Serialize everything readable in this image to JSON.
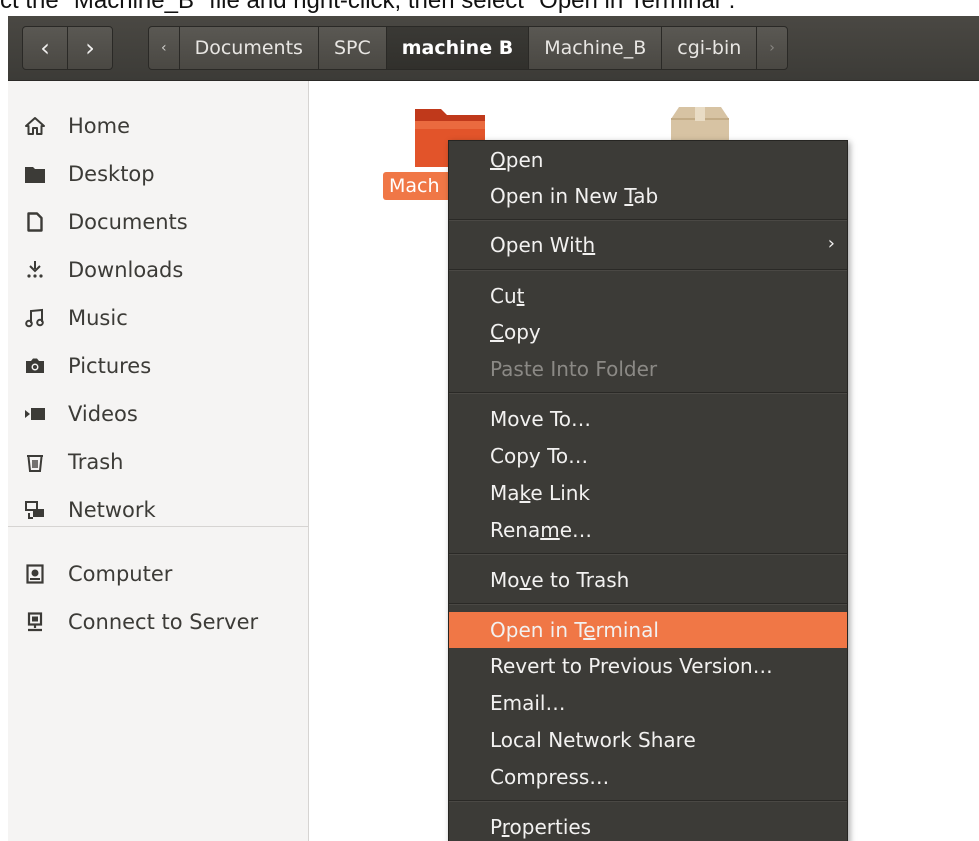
{
  "caption": {
    "text": "ct the \"Machine_B\" file and right-click, then select \"Open in Terminal\"."
  },
  "toolbar": {
    "back_glyph": "‹",
    "forward_glyph": "›",
    "crumb_left_arrow": "‹",
    "crumbs": [
      "Documents",
      "SPC",
      "machine B",
      "Machine_B",
      "cgi-bin"
    ],
    "crumb_right_arrow": "›"
  },
  "sidebar": {
    "items": [
      {
        "label": "Home",
        "icon": "home-icon"
      },
      {
        "label": "Desktop",
        "icon": "desktop-icon"
      },
      {
        "label": "Documents",
        "icon": "document-icon"
      },
      {
        "label": "Downloads",
        "icon": "download-icon"
      },
      {
        "label": "Music",
        "icon": "music-icon"
      },
      {
        "label": "Pictures",
        "icon": "camera-icon"
      },
      {
        "label": "Videos",
        "icon": "video-icon"
      },
      {
        "label": "Trash",
        "icon": "trash-icon"
      },
      {
        "label": "Network",
        "icon": "network-icon"
      },
      {
        "label": "Computer",
        "icon": "computer-icon"
      },
      {
        "label": "Connect to Server",
        "icon": "server-icon"
      }
    ]
  },
  "main": {
    "folder_label": "Mach",
    "folder_color": "#e2542a",
    "selection_color": "#f07746"
  },
  "context_menu": {
    "items": [
      {
        "pre": "",
        "u": "O",
        "post": "pen"
      },
      {
        "pre": "Open in New ",
        "u": "T",
        "post": "ab"
      },
      {
        "pre": "Open Wit",
        "u": "h",
        "post": "",
        "arrow": "›"
      },
      {
        "pre": "Cu",
        "u": "t",
        "post": ""
      },
      {
        "pre": "",
        "u": "C",
        "post": "opy"
      },
      {
        "pre": "Paste Into Folder",
        "u": "",
        "post": ""
      },
      {
        "pre": "Move To…",
        "u": "",
        "post": ""
      },
      {
        "pre": "Copy To…",
        "u": "",
        "post": ""
      },
      {
        "pre": "Ma",
        "u": "k",
        "post": "e Link"
      },
      {
        "pre": "Rena",
        "u": "m",
        "post": "e…"
      },
      {
        "pre": "Mo",
        "u": "v",
        "post": "e to Trash"
      },
      {
        "pre": "Open in T",
        "u": "e",
        "post": "rminal"
      },
      {
        "pre": "Revert to Previous Version…",
        "u": "",
        "post": ""
      },
      {
        "pre": "Email…",
        "u": "",
        "post": ""
      },
      {
        "pre": "Local Network Share",
        "u": "",
        "post": ""
      },
      {
        "pre": "Compress…",
        "u": "",
        "post": ""
      },
      {
        "pre": "P",
        "u": "r",
        "post": "operties"
      }
    ],
    "highlight_color": "#f07746",
    "background_color": "#3c3b37"
  }
}
